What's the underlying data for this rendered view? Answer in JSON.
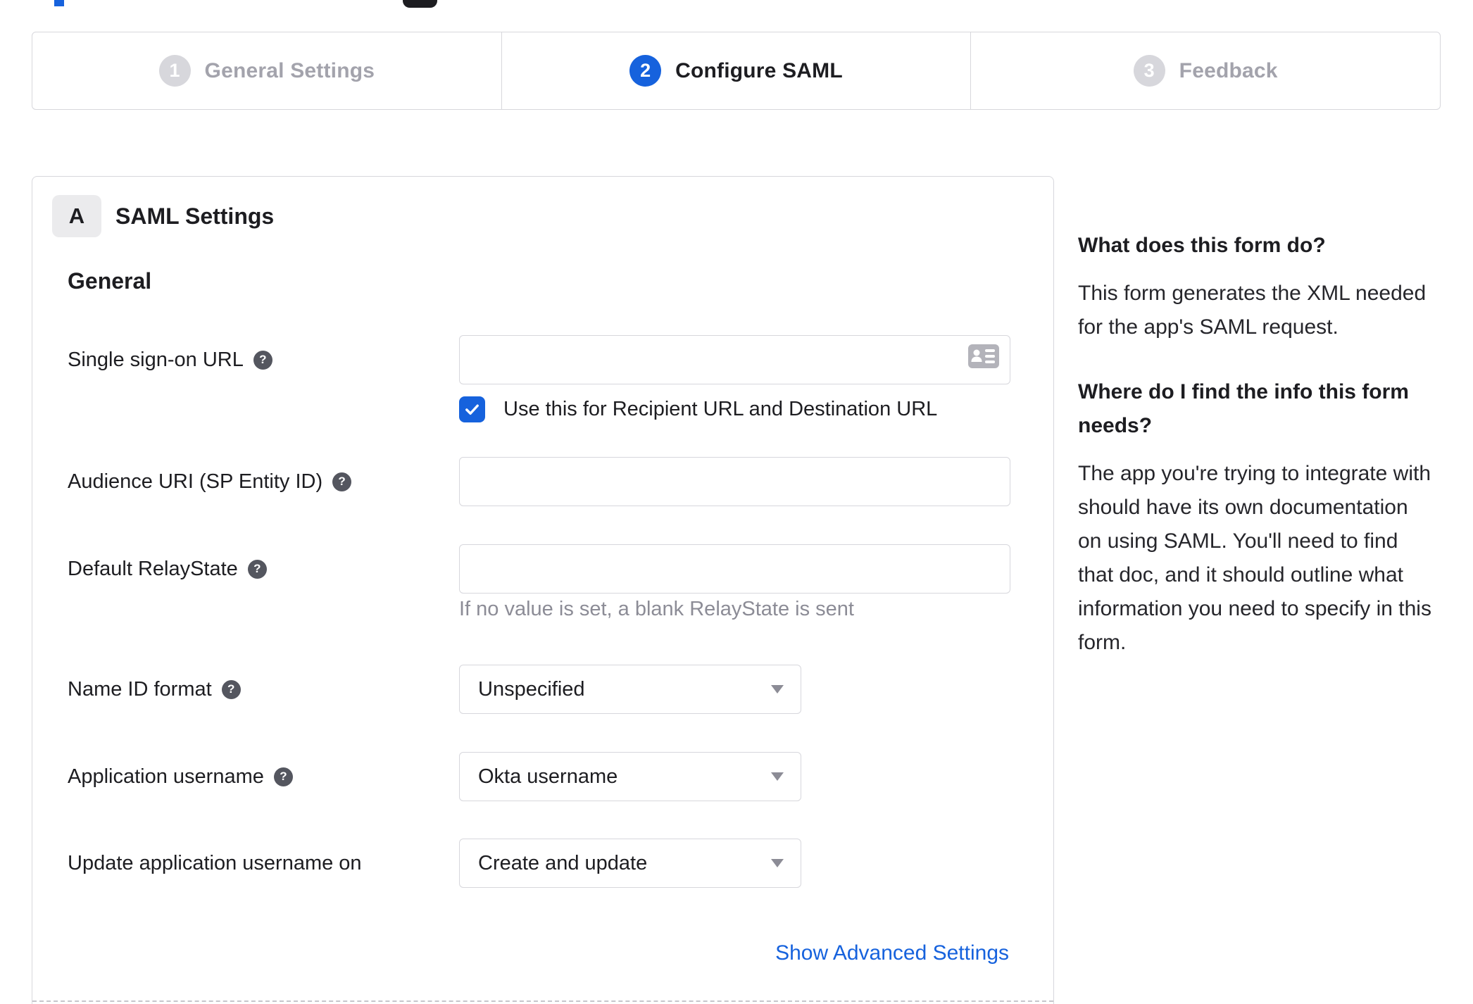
{
  "colors": {
    "accent_blue": "#1662dd",
    "border_gray": "#d7d7dc",
    "inactive_gray": "#a3a3ac",
    "hint_gray": "#8c8c96",
    "help_icon_bg": "#54565f",
    "text_dark": "#1d1d21"
  },
  "stepper": {
    "steps": [
      {
        "number": "1",
        "label": "General Settings",
        "state": "inactive"
      },
      {
        "number": "2",
        "label": "Configure SAML",
        "state": "active"
      },
      {
        "number": "3",
        "label": "Feedback",
        "state": "inactive"
      }
    ]
  },
  "panel": {
    "section_badge": "A",
    "section_title": "SAML Settings",
    "group_heading": "General",
    "fields": {
      "sso_url": {
        "label": "Single sign-on URL",
        "value": "",
        "has_help": true,
        "icon": "contact-card-icon",
        "checkbox_label": "Use this for Recipient URL and Destination URL",
        "checkbox_checked": true
      },
      "audience_uri": {
        "label": "Audience URI (SP Entity ID)",
        "value": "",
        "has_help": true
      },
      "relay_state": {
        "label": "Default RelayState",
        "value": "",
        "has_help": true,
        "hint": "If no value is set, a blank RelayState is sent"
      },
      "name_id_format": {
        "label": "Name ID format",
        "value": "Unspecified",
        "has_help": true
      },
      "app_username": {
        "label": "Application username",
        "value": "Okta username",
        "has_help": true
      },
      "update_app_username": {
        "label": "Update application username on",
        "value": "Create and update",
        "has_help": false
      }
    },
    "advanced_link": "Show Advanced Settings"
  },
  "sidebar": {
    "heading1": "What does this form do?",
    "para1": "This form generates the XML needed for the app's SAML request.",
    "heading2": "Where do I find the info this form needs?",
    "para2": "The app you're trying to integrate with should have its own documentation on using SAML. You'll need to find that doc, and it should outline what information you need to specify in this form."
  }
}
